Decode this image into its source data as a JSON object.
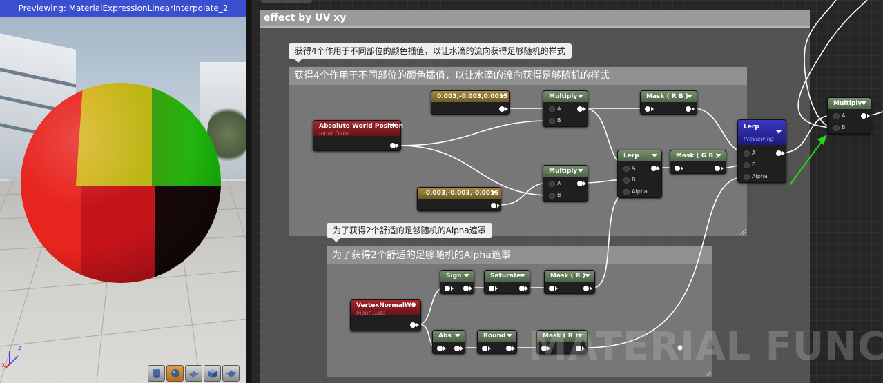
{
  "viewport": {
    "title": "Previewing: MaterialExpressionLinearInterpolate_2",
    "axis_x": "x",
    "axis_z": "z",
    "toolbar": [
      {
        "icon": "cylinder-icon"
      },
      {
        "icon": "sphere-icon",
        "active": true
      },
      {
        "icon": "plane-icon"
      },
      {
        "icon": "cube-icon"
      },
      {
        "icon": "teapot-icon"
      }
    ]
  },
  "graph": {
    "outer_comment": "effect by UV xy",
    "group1": {
      "bubble": "获得4个作用于不同部位的颜色插值，以让水滴的流向获得足够随机的样式",
      "header": "获得4个作用于不同部位的颜色插值，以让水滴的流向获得足够随机的样式"
    },
    "group2": {
      "bubble": "为了获得2个舒适的足够随机的Alpha遮罩",
      "header": "为了获得2个舒适的足够随机的Alpha遮罩"
    },
    "nodes": {
      "const1": {
        "title": "0.003,-0.003,0.0015"
      },
      "const2": {
        "title": "-0.003,-0.003,-0.0015"
      },
      "awp": {
        "title": "Absolute World Position",
        "subtitle": "Input Data"
      },
      "multiply1": {
        "title": "Multiply",
        "pin_a": "A",
        "pin_b": "B"
      },
      "multiply2": {
        "title": "Multiply",
        "pin_a": "A",
        "pin_b": "B"
      },
      "mask_rb": {
        "title": "Mask ( R B )"
      },
      "mask_gb": {
        "title": "Mask ( G B )"
      },
      "lerp1": {
        "title": "Lerp",
        "pin_a": "A",
        "pin_b": "B",
        "pin_alpha": "Alpha"
      },
      "lerp2": {
        "title": "Lerp",
        "subtitle": "Previewing",
        "pin_a": "A",
        "pin_b": "B",
        "pin_alpha": "Alpha"
      },
      "multiply3": {
        "title": "Multiply",
        "pin_a": "A",
        "pin_b": "B"
      },
      "vnws": {
        "title": "VertexNormalWS",
        "subtitle": "Input Data"
      },
      "sign": {
        "title": "Sign"
      },
      "saturate": {
        "title": "Saturate"
      },
      "mask_r1": {
        "title": "Mask ( R )"
      },
      "abs": {
        "title": "Abs"
      },
      "round": {
        "title": "Round"
      },
      "mask_r2": {
        "title": "Mask ( R )"
      }
    },
    "watermark": "MATERIAL FUNCTIOI"
  }
}
